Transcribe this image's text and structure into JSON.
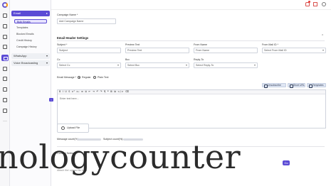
{
  "sidebar": {
    "email_group": "Email",
    "email_items": [
      "Bulk Emails",
      "Templates",
      "Blocked Emails",
      "Credit History",
      "Campaign History"
    ],
    "whatsapp_group": "WhatsApp",
    "voice_group": "Voice Broadcasting",
    "more_label": "···"
  },
  "campaign": {
    "name_label": "Campaign Name *",
    "name_placeholder": "Add Campaign Name"
  },
  "email_header": {
    "title": "Email Header Settings",
    "subject_label": "Subject *",
    "subject_placeholder": "Subject",
    "preview_label": "Preview Text",
    "preview_placeholder": "Preview Text",
    "from_name_label": "From Name",
    "from_name_placeholder": "From Name",
    "from_mail_label": "From Mail ID *",
    "from_mail_placeholder": "Select From Mail ID",
    "cc_label": "Cc",
    "cc_placeholder": "Select Cc",
    "bcc_label": "Bcc",
    "bcc_placeholder": "Select Bcc",
    "reply_label": "Reply-To",
    "reply_placeholder": "Select Reply-To"
  },
  "message": {
    "label": "Email Message *",
    "type_regular": "Regular",
    "type_plain": "Plain Text",
    "btn_unsubscribe": "Unsubscribe",
    "btn_short_url": "Short URL",
    "btn_templates": "Templates",
    "toolbar_text": "B I U S x² x₂ ≡ ≣ ⇤ ⇥ ↶ ↷ ¶ ❝ ⊞ ⧉ </> ⌫",
    "editor_placeholder": "Enter text here...",
    "upload_label": "Upload File",
    "message_count_label": "Message count(%):",
    "subject_count_label": "Subject count(%):"
  },
  "lower": {
    "settings_label": "Content Settings",
    "send_label": "Go",
    "attach_label": "Attach file/ upload file here"
  },
  "watermark": "nologycounter"
}
